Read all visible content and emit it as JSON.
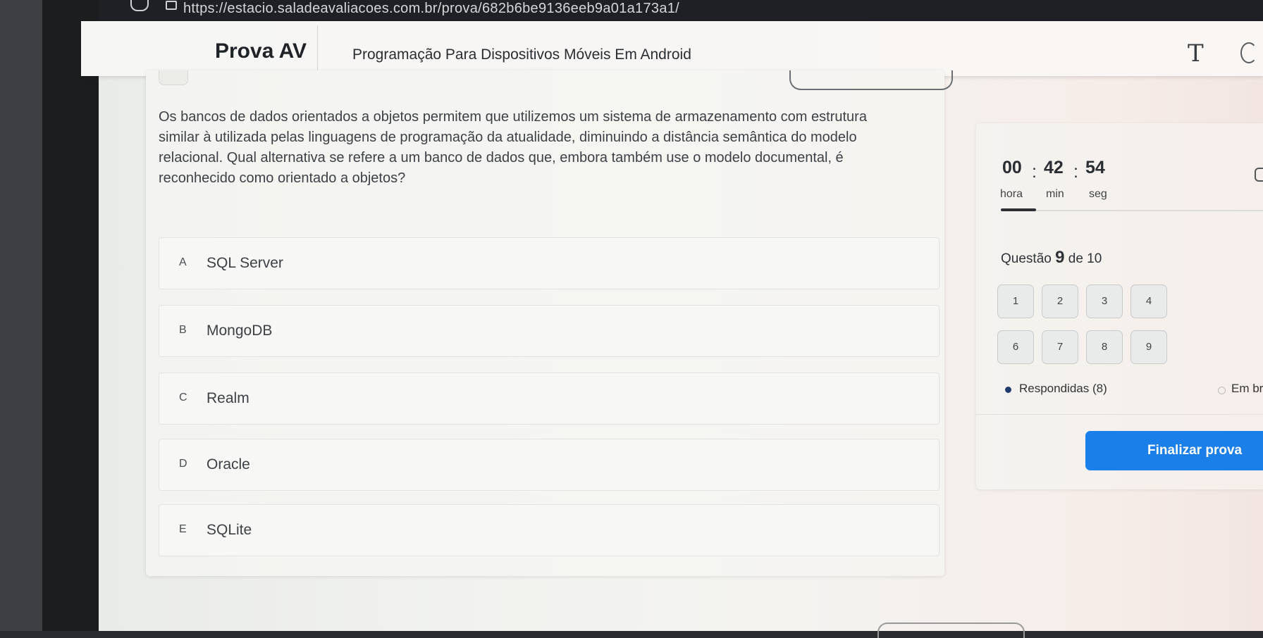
{
  "browser": {
    "url": "https://estacio.saladeavaliacoes.com.br/prova/682b6be9136eeb9a01a173a1/"
  },
  "header": {
    "title": "Prova AV",
    "subject": "Programação Para Dispositivos Móveis Em Android",
    "font_icon": "T"
  },
  "question": {
    "text": "Os bancos de dados orientados a objetos permitem que utilizemos um sistema de armazenamento com estrutura similar à utilizada pelas linguagens de programação da atualidade, diminuindo a distância semântica do modelo relacional. Qual alternativa se refere a um banco de dados que, embora também use o modelo documental, é reconhecido como orientado a objetos?",
    "options": [
      {
        "letter": "A",
        "text": "SQL Server"
      },
      {
        "letter": "B",
        "text": "MongoDB"
      },
      {
        "letter": "C",
        "text": "Realm"
      },
      {
        "letter": "D",
        "text": "Oracle"
      },
      {
        "letter": "E",
        "text": "SQLite"
      }
    ]
  },
  "timer": {
    "hours": "00",
    "minutes": "42",
    "seconds": "54",
    "hours_label": "hora",
    "minutes_label": "min",
    "seconds_label": "seg",
    "separator": ":"
  },
  "progress": {
    "prefix": "Questão",
    "current": "9",
    "suffix": "de 10",
    "buttons": [
      "1",
      "2",
      "3",
      "4",
      "6",
      "7",
      "8",
      "9"
    ]
  },
  "legend": {
    "answered": "Respondidas (8)",
    "other": "Em br"
  },
  "finish_label": "Finalizar prova",
  "colors": {
    "accent": "#1a7fe8",
    "answered_dot": "#1e3b6e"
  }
}
